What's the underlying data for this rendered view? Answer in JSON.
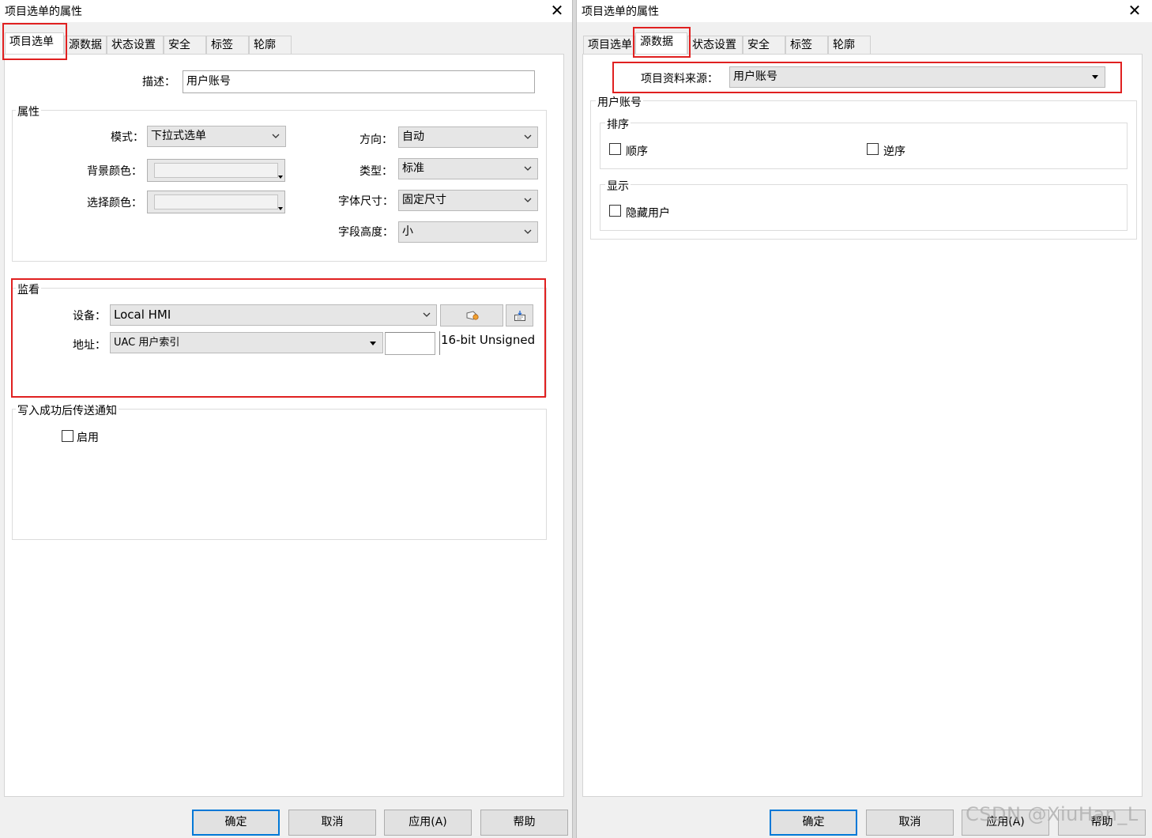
{
  "left_dialog": {
    "title": "项目选单的属性",
    "tabs": [
      "项目选单",
      "源数据",
      "状态设置",
      "安全",
      "标签",
      "轮廓"
    ],
    "description_label": "描述：",
    "description_value": "用户账号",
    "properties_group": {
      "title": "属性",
      "mode_label": "模式：",
      "mode_value": "下拉式选单",
      "bg_color_label": "背景颜色：",
      "select_color_label": "选择颜色：",
      "direction_label": "方向：",
      "direction_value": "自动",
      "type_label": "类型：",
      "type_value": "标准",
      "font_size_label": "字体尺寸：",
      "font_size_value": "固定尺寸",
      "field_height_label": "字段高度：",
      "field_height_value": "小"
    },
    "monitor_group": {
      "title": "监看",
      "device_label": "设备：",
      "device_value": "Local HMI",
      "address_label": "地址：",
      "address_value": "UAC 用户索引",
      "address_index_value": "",
      "data_type": "16-bit Unsigned"
    },
    "notify_group": {
      "title": "写入成功后传送通知",
      "enable_label": "启用"
    }
  },
  "right_dialog": {
    "title": "项目选单的属性",
    "tabs": [
      "项目选单",
      "源数据",
      "状态设置",
      "安全",
      "标签",
      "轮廓"
    ],
    "source_label": "项目资料来源：",
    "source_value": "用户账号",
    "user_account_group": {
      "title": "用户账号",
      "sort_group_title": "排序",
      "ascending_label": "顺序",
      "descending_label": "逆序",
      "display_group_title": "显示",
      "hide_user_label": "隐藏用户"
    }
  },
  "buttons": {
    "ok": "确定",
    "cancel": "取消",
    "apply": "应用(A)",
    "help": "帮助"
  },
  "icons": {
    "close": "close-icon",
    "chevron": "chevron-down-icon",
    "device_settings": "device-settings-icon",
    "address_picker": "address-picker-icon"
  },
  "colors": {
    "highlight_border": "#e02020",
    "default_button_border": "#0078d7"
  },
  "watermark": "CSDN @XiuHan_L"
}
